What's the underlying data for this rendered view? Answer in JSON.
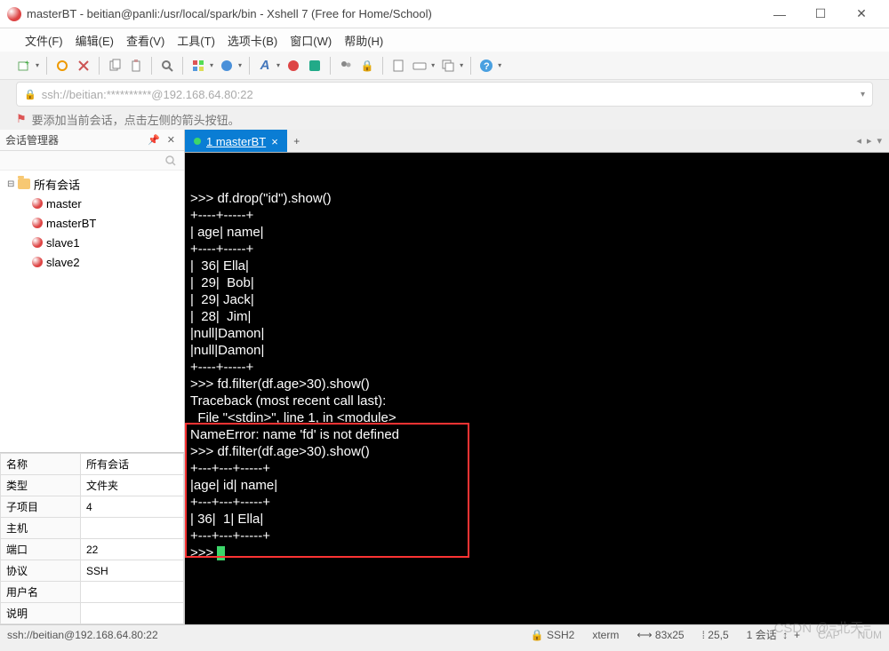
{
  "title": "masterBT - beitian@panli:/usr/local/spark/bin - Xshell 7 (Free for Home/School)",
  "menu": [
    "文件(F)",
    "编辑(E)",
    "查看(V)",
    "工具(T)",
    "选项卡(B)",
    "窗口(W)",
    "帮助(H)"
  ],
  "address": "ssh://beitian:**********@192.168.64.80:22",
  "hint": "要添加当前会话，点击左侧的箭头按钮。",
  "sidebar": {
    "title": "会话管理器",
    "root": "所有会话",
    "sessions": [
      "master",
      "masterBT",
      "slave1",
      "slave2"
    ]
  },
  "props": [
    [
      "名称",
      "所有会话"
    ],
    [
      "类型",
      "文件夹"
    ],
    [
      "子项目",
      "4"
    ],
    [
      "主机",
      ""
    ],
    [
      "端口",
      "22"
    ],
    [
      "协议",
      "SSH"
    ],
    [
      "用户名",
      ""
    ],
    [
      "说明",
      ""
    ]
  ],
  "tab": {
    "label": "1 masterBT",
    "dot": true
  },
  "terminal_lines": [
    ">>> df.drop(\"id\").show()",
    "+----+-----+",
    "| age| name|",
    "+----+-----+",
    "|  36| Ella|",
    "|  29|  Bob|",
    "|  29| Jack|",
    "|  28|  Jim|",
    "|null|Damon|",
    "|null|Damon|",
    "+----+-----+",
    "",
    ">>> fd.filter(df.age>30).show()",
    "Traceback (most recent call last):",
    "  File \"<stdin>\", line 1, in <module>",
    "NameError: name 'fd' is not defined",
    ">>> df.filter(df.age>30).show()",
    "+---+---+-----+",
    "|age| id| name|",
    "+---+---+-----+",
    "| 36|  1| Ella|",
    "+---+---+-----+",
    "",
    ">>> "
  ],
  "status": {
    "left": "ssh://beitian@192.168.64.80:22",
    "ssh": "SSH2",
    "term": "xterm",
    "size": "83x25",
    "pos": "25,5",
    "sessions": "1 会话",
    "caps": "CAP",
    "num": "NUM"
  },
  "watermark": "CSDN @=北天="
}
